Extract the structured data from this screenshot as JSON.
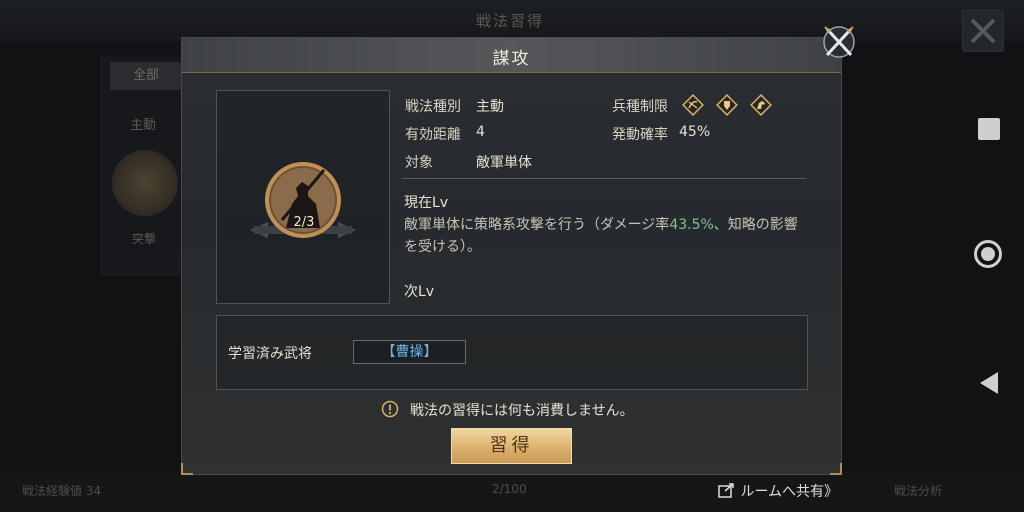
{
  "background": {
    "title": "戦法習得",
    "tab_all": "全部",
    "subtab": "主動",
    "avatar_label": "突撃",
    "bottom_left": "戦法経験値 34",
    "bottom_mid": "2/100",
    "bottom_right": "戦法分析"
  },
  "dialog": {
    "title": "謀攻",
    "skill_level": "2/3",
    "type_label": "戦法種別",
    "type_value": "主動",
    "range_label": "有効距離",
    "range_value": "4",
    "target_label": "対象",
    "target_value": "敵軍単体",
    "troop_label": "兵種制限",
    "troop_icons": [
      "bow-cavalry-icon",
      "shield-icon",
      "horse-icon"
    ],
    "rate_label": "発動確率",
    "rate_value": "45%",
    "current_lv_label": "現在Lv",
    "current_desc_prefix": "敵軍単体に策略系攻撃を行う（ダメージ率",
    "current_desc_value": "43.5%",
    "current_desc_suffix": "、知略の影響を受ける）。",
    "next_lv_label": "次Lv",
    "learned_label": "学習済み武将",
    "learned_general": "【曹操】",
    "notice": "戦法の習得には何も消費しません。",
    "learn_button": "習得"
  },
  "share_label": "ルームへ共有》",
  "colors": {
    "highlight": "#7fc48b",
    "general_name": "#6fb3e3",
    "button_gold": "#d9ae6a"
  }
}
